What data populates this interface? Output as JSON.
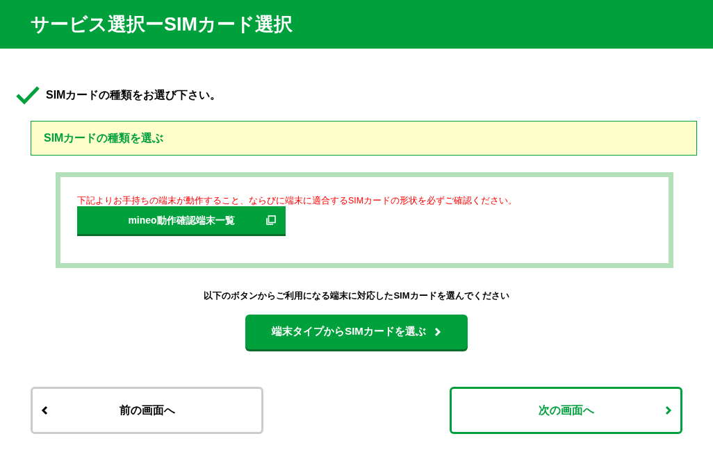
{
  "header": {
    "title": "サービス選択ーSIMカード選択"
  },
  "instruction": "SIMカードの種類をお選び下さい。",
  "section": {
    "title": "SIMカードの種類を選ぶ"
  },
  "notice": {
    "text": "下記よりお手持ちの端末が動作すること、ならびに端末に適合するSIMカードの形状を必ずご確認ください。",
    "button": "mineo動作確認端末一覧"
  },
  "guide": "以下のボタンからご利用になる端末に対応したSIMカードを選んでください",
  "select_button": "端末タイプからSIMカードを選ぶ",
  "nav": [
    {
      "label": "前の画面へ",
      "kind": "back"
    },
    {
      "label": "次の画面へ",
      "kind": "next"
    }
  ]
}
